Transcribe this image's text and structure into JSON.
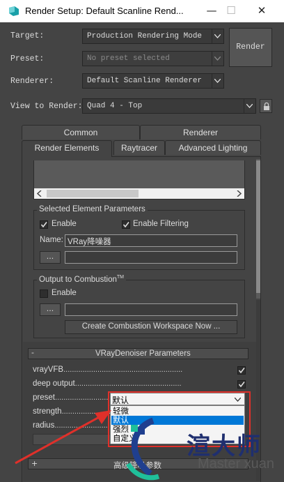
{
  "window": {
    "title": "Render Setup: Default Scanline Rend...",
    "minimize": "—",
    "maximize": "☐",
    "close": "✕"
  },
  "setup": {
    "target_label": "Target:",
    "target_value": "Production Rendering Mode",
    "preset_label": "Preset:",
    "preset_value": "No preset selected",
    "renderer_label": "Renderer:",
    "renderer_value": "Default Scanline Renderer",
    "view_label": "View to Render:",
    "view_value": "Quad 4 - Top",
    "render_button": "Render"
  },
  "tabs": {
    "row1": [
      "Common",
      "Renderer"
    ],
    "row2": [
      "Render Elements",
      "Raytracer",
      "Advanced Lighting"
    ],
    "active": "Render Elements"
  },
  "selected_element": {
    "group_title": "Selected Element Parameters",
    "enable_label": "Enable",
    "enable_checked": true,
    "filtering_label": "Enable Filtering",
    "filtering_checked": true,
    "name_label": "Name:",
    "name_value": "VRay降噪器",
    "browse_button": "..."
  },
  "combustion": {
    "group_title": "Output to Combustion",
    "group_title_tm": "TM",
    "enable_label": "Enable",
    "enable_checked": false,
    "browse_button": "...",
    "create_button": "Create Combustion Workspace Now ..."
  },
  "denoiser": {
    "rollout_toggle": "-",
    "rollout_title": "VRayDenoiser Parameters",
    "params": [
      {
        "label": "vrayVFB",
        "checked": true
      },
      {
        "label": "deep output",
        "checked": true
      },
      {
        "label": "preset",
        "checked": null
      },
      {
        "label": "strength",
        "checked": null
      },
      {
        "label": "radius",
        "checked": null
      }
    ],
    "preset_value": "默认",
    "preset_options": [
      "轻微",
      "默认",
      "强烈",
      "自定义"
    ],
    "preset_selected": "默认",
    "advanced_toggle": "+",
    "advanced_title": "高级降噪参数"
  },
  "watermark": {
    "brand": "渲大师",
    "sub": "Master xuan"
  },
  "colors": {
    "background": "#444444",
    "highlight": "#0078d7",
    "annotation_red": "#e0302a"
  }
}
